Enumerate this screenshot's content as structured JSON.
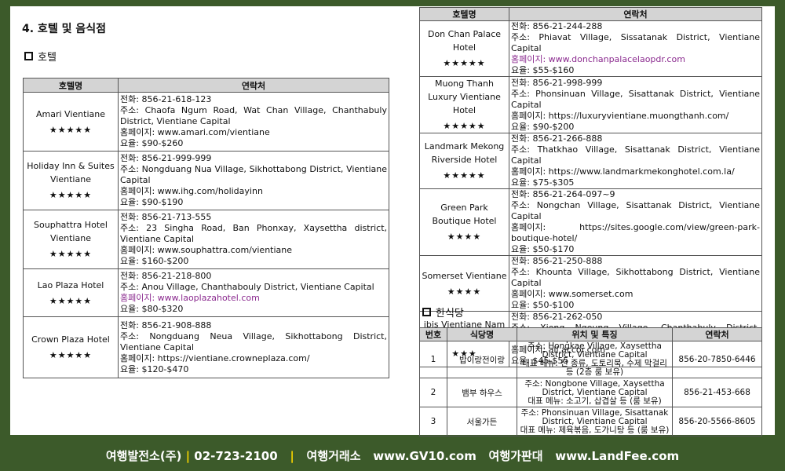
{
  "section_title": "4. 호텔 및 음식점",
  "hotel_heading": "호텔",
  "restaurant_heading": "한식당",
  "hotel_table": {
    "headers": [
      "호텔명",
      "연락처"
    ],
    "left_rows": [
      {
        "name": "Amari Vientiane",
        "stars": "★★★★★",
        "lines": [
          "전화: 856-21-618-123",
          "주소: Chaofa Ngum Road, Wat Chan Village, Chanthabuly District, Vientiane Capital",
          "홈페이지: www.amari.com/vientiane",
          "요율: $90-$260"
        ]
      },
      {
        "name": "Holiday Inn & Suites Vientiane",
        "stars": "★★★★★",
        "lines": [
          "전화: 856-21-999-999",
          "주소: Nongduang Nua Village, Sikhottabong District, Vientiane Capital",
          "홈페이지: www.ihg.com/holidayinn",
          "요율: $90-$190"
        ]
      },
      {
        "name": "Souphattra Hotel Vientiane",
        "stars": "★★★★★",
        "lines": [
          "전화: 856-21-713-555",
          "주소: 23 Singha Road, Ban Phonxay, Xaysettha district, Vientiane Capital",
          "홈페이지: www.souphattra.com/vientiane",
          "요율: $160-$200"
        ]
      },
      {
        "name": "Lao Plaza Hotel",
        "stars": "★★★★★",
        "lines": [
          "전화: 856-21-218-800",
          "주소: Anou Village, Chanthabouly District, Vientiane Capital",
          "홈페이지: www.laoplazahotel.com",
          "요율: $80-$320"
        ]
      },
      {
        "name": "Crown Plaza Hotel",
        "stars": "★★★★★",
        "lines": [
          "전화: 856-21-908-888",
          "주소: Nongduang Neua Village, Sikhottabong District, Vientiane Capital",
          "홈페이지: https://vientiane.crowneplaza.com/",
          "요율: $120-$470"
        ]
      }
    ],
    "right_rows": [
      {
        "name": "Don Chan Palace Hotel",
        "stars": "★★★★★",
        "lines": [
          "전화: 856-21-244-288",
          "주소: Phiavat Village, Sissatanak District, Vientiane Capital",
          "홈페이지: www.donchanpalacelaopdr.com",
          "요율: $55-$160"
        ]
      },
      {
        "name": "Muong Thanh Luxury Vientiane Hotel",
        "stars": "★★★★★",
        "lines": [
          "전화: 856-21-998-999",
          "주소: Phonsinuan Village, Sisattanak District, Vientiane Capital",
          "홈페이지: https://luxuryvientiane.muongthanh.com/",
          "요율: $90-$200"
        ]
      },
      {
        "name": "Landmark Mekong Riverside Hotel",
        "stars": "★★★★★",
        "lines": [
          "전화: 856-21-266-888",
          "주소: Thatkhao Village, Sisattanak District, Vientiane Capital",
          "홈페이지: https://www.landmarkmekonghotel.com.la/",
          "요율: $75-$305"
        ]
      },
      {
        "name": "Green Park Boutique Hotel",
        "stars": "★★★★",
        "lines": [
          "전화: 856-21-264-097~9",
          "주소: Nongchan Village, Sisattanak District, Vientiane Capital",
          "홈페이지: https://sites.google.com/view/green-park-boutique-hotel/",
          "요율: $50-$170"
        ]
      },
      {
        "name": "Somerset Vientiane",
        "stars": "★★★★",
        "lines": [
          "전화: 856-21-250-888",
          "주소: Khounta Village, Sikhottabong District, Vientiane Capital",
          "홈페이지: www.somerset.com",
          "요율: $50-$100"
        ]
      },
      {
        "name": "ibis Vientiane Nam Phu",
        "stars": "★★★",
        "lines": [
          "전화: 856-21-262-050",
          "주소: Xieng Ngeung Village, Chanthabuly District, Vientiane Capital",
          "홈페이지: all.accor.com",
          "요율: $45-$55"
        ]
      }
    ]
  },
  "restaurant_table": {
    "headers": [
      "번호",
      "식당명",
      "위치 및 특징",
      "연락처"
    ],
    "rows": [
      {
        "no": "1",
        "name": "밥이랑전이랑",
        "addr": "주소: Hongkae Village, Xaysettha District, Vientiane Capital",
        "menu": "대표 메뉴: 전 종류, 도토리묵, 수제 막걸리 등 (2층 룸 보유)",
        "phone": "856-20-7850-6446"
      },
      {
        "no": "2",
        "name": "뱀부 하우스",
        "addr": "주소: Nongbone Village, Xaysettha District, Vientiane Capital",
        "menu": "대표 메뉴: 소고기, 삽겹살 등 (룸 보유)",
        "phone": "856-21-453-668"
      },
      {
        "no": "3",
        "name": "서울가든",
        "addr": "주소: Phonsinuan Village, Sisattanak District, Vientiane Capital",
        "menu": "대표 메뉴: 제육볶음, 도가니탕 등 (룸 보유)",
        "phone": "856-20-5566-8605"
      }
    ]
  },
  "footer": {
    "company": "여행발전소(주)",
    "phone": "02-723-2100",
    "exchange_label": "여행거래소",
    "exchange_url": "www.GV10.com",
    "market_label": "여행가판대",
    "market_url": "www.LandFee.com"
  },
  "colors": {
    "background": "#3c5a2a",
    "header_fill": "#d4d4d4",
    "link_purple": "#8b2b8f",
    "footer_separator": "#f2d100"
  }
}
